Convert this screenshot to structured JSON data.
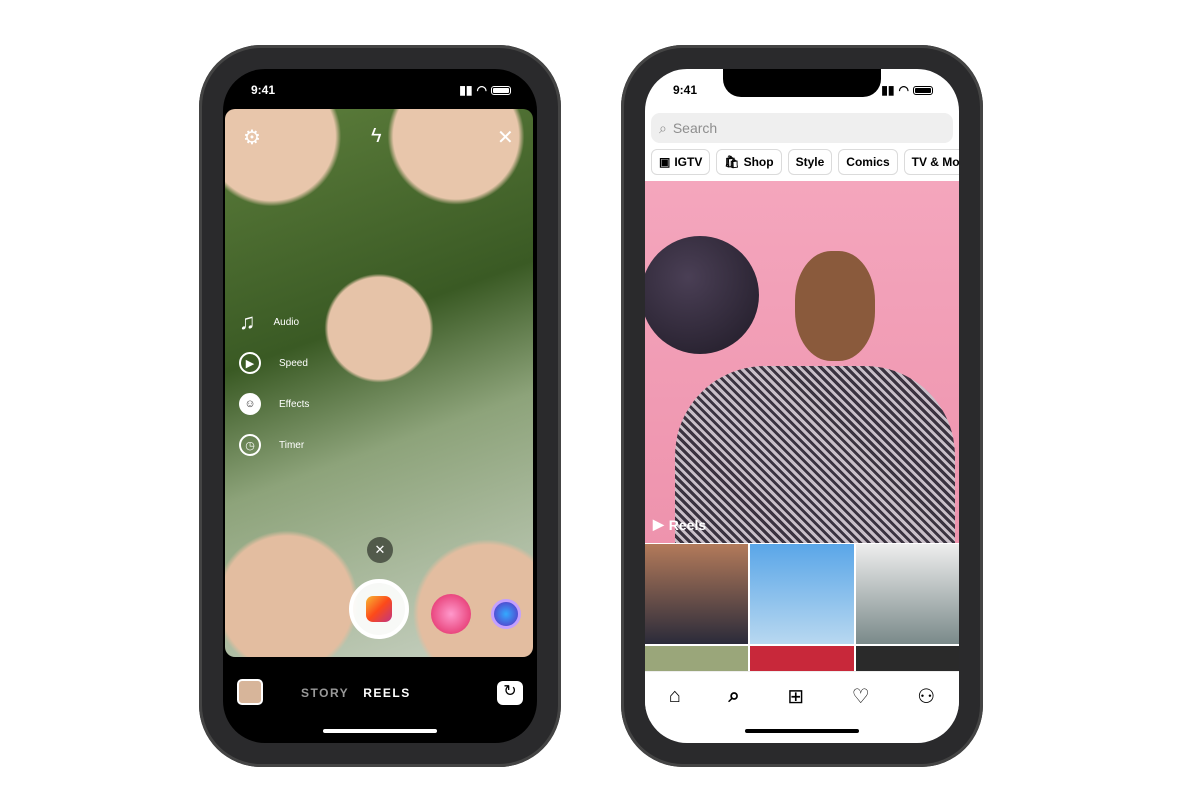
{
  "left_phone": {
    "time": "9:41",
    "top_icons": [
      "settings-icon",
      "flash-icon",
      "close-icon"
    ],
    "tools": [
      {
        "label": "Audio",
        "icon": "music-note-icon"
      },
      {
        "label": "Speed",
        "icon": "speed-icon"
      },
      {
        "label": "Effects",
        "icon": "effects-face-icon"
      },
      {
        "label": "Timer",
        "icon": "timer-icon"
      }
    ],
    "modes": [
      "STORY",
      "REELS"
    ],
    "active_mode": "REELS"
  },
  "right_phone": {
    "time": "9:41",
    "search_placeholder": "Search",
    "chips": [
      {
        "label": "IGTV",
        "icon": "igtv-icon"
      },
      {
        "label": "Shop",
        "icon": "shop-bag-icon"
      },
      {
        "label": "Style"
      },
      {
        "label": "Comics"
      },
      {
        "label": "TV & Movie"
      }
    ],
    "reels_label": "Reels",
    "nav": [
      "home-icon",
      "search-icon",
      "add-icon",
      "heart-icon",
      "profile-icon"
    ]
  }
}
